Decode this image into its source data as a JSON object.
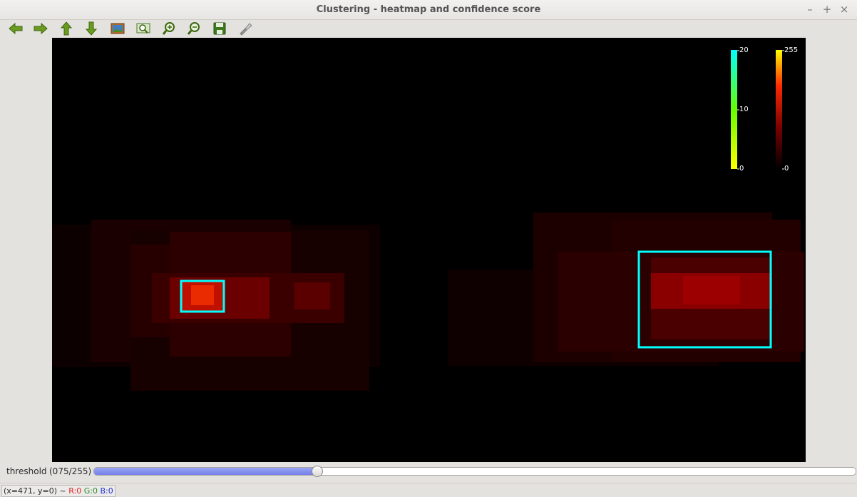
{
  "window": {
    "title": "Clustering - heatmap and confidence score",
    "controls": {
      "minimize": "–",
      "maximize": "+",
      "close": "×"
    }
  },
  "toolbar": {
    "buttons": [
      {
        "name": "back-arrow-icon",
        "color": "#6a9a1e"
      },
      {
        "name": "forward-arrow-icon",
        "color": "#6a9a1e"
      },
      {
        "name": "up-arrow-icon",
        "color": "#6a9a1e"
      },
      {
        "name": "down-arrow-icon",
        "color": "#6a9a1e"
      },
      {
        "name": "image-icon",
        "color": "#b36b2d"
      },
      {
        "name": "zoom-fit-icon",
        "color": "#4a7a2a"
      },
      {
        "name": "zoom-in-icon",
        "color": "#3f7a1f"
      },
      {
        "name": "zoom-out-icon",
        "color": "#3f7a1f"
      },
      {
        "name": "save-icon",
        "color": "#3f7a1f"
      },
      {
        "name": "properties-icon",
        "color": "#999999"
      }
    ]
  },
  "colorbars": {
    "confidence": {
      "max": "20",
      "mid": "10",
      "min": "0",
      "top_color": "#00ffff",
      "mid_color": "#66ff00",
      "bottom_color": "#ffff00"
    },
    "heat": {
      "max": "255",
      "min": "0",
      "top_color": "#ffff00",
      "mid_color": "#ff2200",
      "bottom_color": "#000000"
    }
  },
  "heatmap": {
    "box_color": "#00ffff",
    "clusters_color": "#ff0000"
  },
  "trackbar": {
    "label": "threshold",
    "value_text": "(075/255)",
    "value": 75,
    "max": 255
  },
  "status": {
    "coords": "(x=471, y=0) ~",
    "r": "R:0",
    "g": "G:0",
    "b": "B:0"
  }
}
